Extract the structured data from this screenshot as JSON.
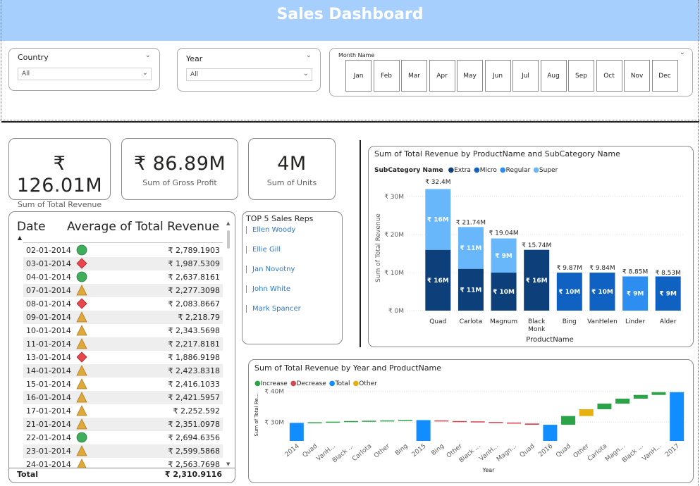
{
  "banner": {
    "title": "Sales Dashboard"
  },
  "filters": {
    "country": {
      "label": "Country",
      "value": "All"
    },
    "year": {
      "label": "Year",
      "value": "All"
    },
    "month": {
      "label": "Month Name",
      "options": [
        "Jan",
        "Feb",
        "Mar",
        "Apr",
        "May",
        "Jun",
        "Jul",
        "Aug",
        "Sep",
        "Oct",
        "Nov",
        "Dec"
      ]
    }
  },
  "cards": [
    {
      "value": "₹ 126.01M",
      "label": "Sum of Total Revenue"
    },
    {
      "value": "₹ 86.89M",
      "label": "Sum of Gross Profit"
    },
    {
      "value": "4M",
      "label": "Sum of Units"
    }
  ],
  "table": {
    "headers": [
      "Date",
      "Average of Total Revenue"
    ],
    "rows": [
      {
        "date": "02-01-2014",
        "indicator": "green-circle",
        "value": "₹ 2,789.1903"
      },
      {
        "date": "03-01-2014",
        "indicator": "red-diamond",
        "value": "₹ 1,987.5309"
      },
      {
        "date": "04-01-2014",
        "indicator": "green-circle",
        "value": "₹ 2,637.8161"
      },
      {
        "date": "07-01-2014",
        "indicator": "yellow-triangle",
        "value": "₹ 2,277.3098"
      },
      {
        "date": "08-01-2014",
        "indicator": "red-diamond",
        "value": "₹ 2,083.8667"
      },
      {
        "date": "09-01-2014",
        "indicator": "yellow-triangle",
        "value": "₹ 2,218.79"
      },
      {
        "date": "10-01-2014",
        "indicator": "yellow-triangle",
        "value": "₹ 2,343.5698"
      },
      {
        "date": "11-01-2014",
        "indicator": "yellow-triangle",
        "value": "₹ 2,217.8181"
      },
      {
        "date": "13-01-2014",
        "indicator": "red-diamond",
        "value": "₹ 1,886.9198"
      },
      {
        "date": "14-01-2014",
        "indicator": "yellow-triangle",
        "value": "₹ 2,423.8318"
      },
      {
        "date": "15-01-2014",
        "indicator": "yellow-triangle",
        "value": "₹ 2,416.1033"
      },
      {
        "date": "16-01-2014",
        "indicator": "yellow-triangle",
        "value": "₹ 2,421.5957"
      },
      {
        "date": "17-01-2014",
        "indicator": "yellow-triangle",
        "value": "₹ 2,252.592"
      },
      {
        "date": "21-01-2014",
        "indicator": "yellow-triangle",
        "value": "₹ 2,351.0978"
      },
      {
        "date": "22-01-2014",
        "indicator": "green-circle",
        "value": "₹ 2,694.6356"
      },
      {
        "date": "23-01-2014",
        "indicator": "yellow-triangle",
        "value": "₹ 2,599.5868"
      },
      {
        "date": "24-01-2014",
        "indicator": "yellow-triangle",
        "value": "₹ 2,563.7698"
      }
    ],
    "total_label": "Total",
    "total_value": "₹ 2,310.9116",
    "indicator_colors": {
      "green-circle": "#3fae5a",
      "red-diamond": "#e8474b",
      "yellow-triangle": "#e0a93a"
    }
  },
  "reps": {
    "title": "TOP 5 Sales Reps",
    "names": [
      "Ellen Woody",
      "Ellie Gill",
      "Jan Novotny",
      "John White",
      "Mark Spancer"
    ]
  },
  "chart_data": [
    {
      "type": "bar",
      "stacked": true,
      "title": "Sum of Total Revenue by ProductName and SubCategory Name",
      "legend_title": "SubCategory Name",
      "legend_placement": "top-left",
      "xlabel": "ProductName",
      "ylabel": "Sum of Total Revenue",
      "ylim": [
        0,
        33
      ],
      "yticks": [
        "₹ 0M",
        "₹ 10M",
        "₹ 20M",
        "₹ 30M"
      ],
      "grid": true,
      "categories": [
        "Quad",
        "Carlota",
        "Magnum",
        "Black Monk",
        "Bing",
        "VanHelen",
        "Linder",
        "Alder"
      ],
      "series": [
        {
          "name": "Extra",
          "color": "#0d3f7a",
          "values": [
            16,
            11,
            10,
            16,
            0,
            0,
            0,
            0
          ],
          "labels": [
            "₹ 16M",
            "₹ 11M",
            "₹ 10M",
            "₹ 16M",
            "",
            "",
            "",
            ""
          ]
        },
        {
          "name": "Micro",
          "color": "#0f62c2",
          "values": [
            0,
            0,
            0,
            0,
            10,
            10,
            0,
            9
          ],
          "labels": [
            "",
            "",
            "",
            "",
            "₹ 10M",
            "₹ 10M",
            "",
            "₹ 9M"
          ]
        },
        {
          "name": "Regular",
          "color": "#2d8df0",
          "values": [
            0,
            0,
            0,
            0,
            0,
            0,
            9,
            0
          ],
          "labels": [
            "",
            "",
            "",
            "",
            "",
            "",
            "₹ 9M",
            ""
          ]
        },
        {
          "name": "Super",
          "color": "#69b7fb",
          "values": [
            16,
            11,
            9,
            0,
            0,
            0,
            0,
            0
          ],
          "labels": [
            "₹ 16M",
            "₹ 11M",
            "₹ 9M",
            "",
            "",
            "",
            "",
            ""
          ]
        }
      ],
      "totals": [
        "₹ 32.4M",
        "₹ 21.74M",
        "₹ 19.04M",
        "₹ 15.74M",
        "₹ 9.87M",
        "₹ 9.84M",
        "₹ 8.85M",
        "₹ 8.53M"
      ],
      "total_values": [
        32.4,
        21.74,
        19.04,
        15.74,
        9.87,
        9.84,
        8.85,
        8.53
      ]
    },
    {
      "type": "waterfall",
      "title": "Sum of Total Revenue by Year and ProductName",
      "legend": [
        {
          "name": "Increase",
          "color": "#2aa447"
        },
        {
          "name": "Decrease",
          "color": "#d64550"
        },
        {
          "name": "Total",
          "color": "#118dff"
        },
        {
          "name": "Other",
          "color": "#e6b00e"
        }
      ],
      "legend_placement": "top-left",
      "xlabel": "Year",
      "ylabel": "Sum of Total Re...",
      "ylim": [
        24,
        41
      ],
      "yticks": [
        30,
        40
      ],
      "ytick_labels": [
        "₹ 30M",
        "₹ 40M"
      ],
      "categories": [
        "2014",
        "Quad",
        "VanH...",
        "Black ...",
        "Carlota",
        "Other",
        "Bing",
        "2015",
        "Bing",
        "Other",
        "Black ...",
        "VanH...",
        "Magn...",
        "Quad",
        "2016",
        "Quad",
        "Other",
        "Carlota",
        "Magn...",
        "Black ...",
        "VanH...",
        "2017"
      ],
      "kinds": [
        "total",
        "increase",
        "increase",
        "increase",
        "increase",
        "increase",
        "increase",
        "total",
        "decrease",
        "decrease",
        "decrease",
        "decrease",
        "decrease",
        "decrease",
        "total",
        "increase",
        "other",
        "increase",
        "increase",
        "increase",
        "increase",
        "total"
      ],
      "start": [
        24.0,
        29.8,
        30.0,
        30.2,
        30.4,
        30.5,
        30.6,
        24.0,
        30.6,
        30.4,
        30.3,
        30.1,
        29.9,
        29.6,
        24.0,
        29.2,
        32.0,
        34.2,
        36.0,
        37.6,
        38.8,
        24.0
      ],
      "end": [
        29.8,
        30.0,
        30.2,
        30.4,
        30.5,
        30.6,
        30.7,
        30.7,
        30.4,
        30.3,
        30.1,
        29.9,
        29.6,
        29.2,
        29.2,
        32.0,
        34.2,
        36.0,
        37.6,
        38.8,
        39.7,
        39.7
      ]
    }
  ]
}
